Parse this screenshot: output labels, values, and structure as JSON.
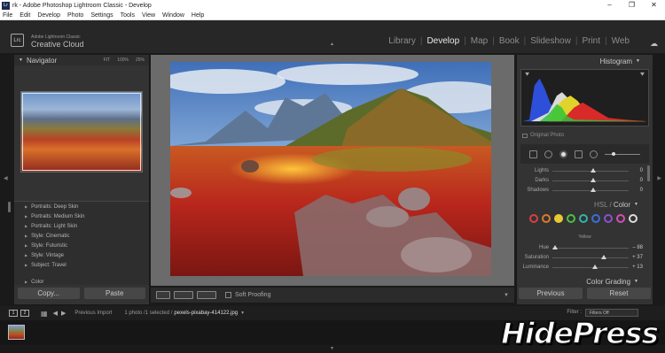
{
  "window": {
    "title": "rk - Adobe Photoshop Lightroom Classic - Develop",
    "app_icon_text": "Lr",
    "controls": [
      "–",
      "❐",
      "✕"
    ]
  },
  "menu": [
    "File",
    "Edit",
    "Develop",
    "Photo",
    "Settings",
    "Tools",
    "View",
    "Window",
    "Help"
  ],
  "identity": {
    "logo": "Lrc",
    "line1": "Adobe Lightroom Classic",
    "line2": "Creative Cloud"
  },
  "modules": [
    "Library",
    "Develop",
    "Map",
    "Book",
    "Slideshow",
    "Print",
    "Web"
  ],
  "active_module": "Develop",
  "navigator": {
    "title": "Navigator",
    "zoom_options": [
      "FIT",
      "100%",
      "25%"
    ]
  },
  "presets": [
    "Portraits: Deep Skin",
    "Portraits: Medium Skin",
    "Portraits: Light Skin",
    "Style: Cinematic",
    "Style: Futuristic",
    "Style: Vintage",
    "Subject: Travel"
  ],
  "color_preset_group": "Color",
  "left_buttons": {
    "copy": "Copy...",
    "paste": "Paste"
  },
  "toolbar": {
    "soft_proofing": "Soft Proofing"
  },
  "histogram": {
    "title": "Histogram",
    "original_photo": "Original Photo"
  },
  "tone_sliders": [
    {
      "label": "Lights",
      "value": "0"
    },
    {
      "label": "Darks",
      "value": "0"
    },
    {
      "label": "Shadows",
      "value": "0"
    }
  ],
  "hsl": {
    "title_part1": "HSL /",
    "title_part2": "Color",
    "selected_color": "Yellow"
  },
  "hsl_colors": [
    "#d94040",
    "#e07a2a",
    "#e6c935",
    "#4fbf45",
    "#2fb5a8",
    "#3a6fd9",
    "#8d4fd0",
    "#d14fb2",
    "#dddddd"
  ],
  "hsl_sliders": [
    {
      "label": "Hue",
      "value": "– 88",
      "level": 0.04
    },
    {
      "label": "Saturation",
      "value": "+ 37",
      "level": 0.68
    },
    {
      "label": "Luminance",
      "value": "+ 13",
      "level": 0.56
    }
  ],
  "color_grading": "Color Grading",
  "right_buttons": {
    "previous": "Previous",
    "reset": "Reset"
  },
  "filmstrip": {
    "monitor1": "1",
    "monitor2": "2",
    "previous_import": "Previous Import",
    "info": "1 photo /1 selected /",
    "filename": "pexels-pixabay-414122.jpg",
    "filter_label": "Filter :",
    "filter_value": "Filters Off"
  },
  "watermark": "HidePress"
}
